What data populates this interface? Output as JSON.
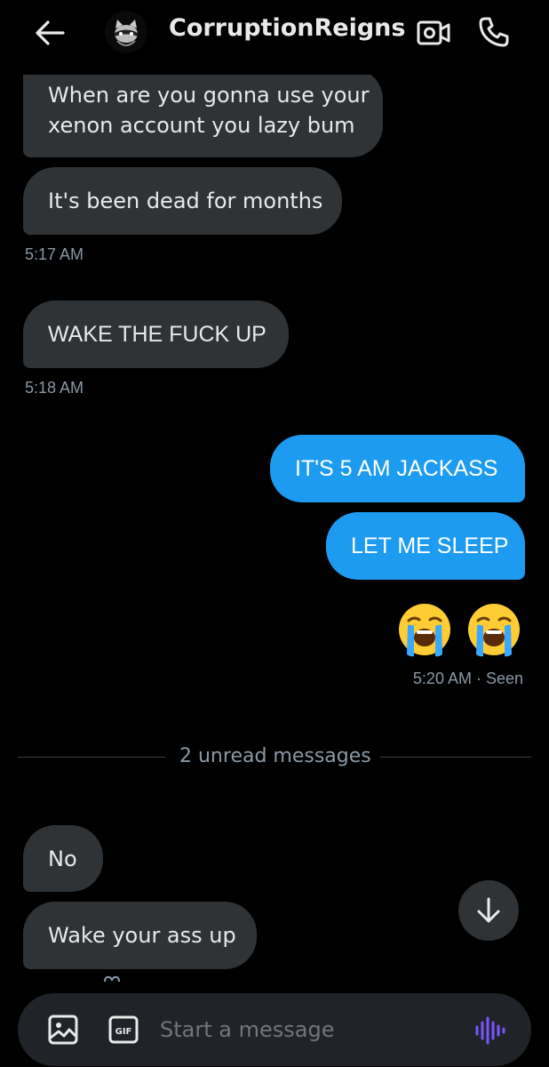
{
  "header": {
    "contact_name": "CorruptionReigns",
    "icons": {
      "back": "arrow-left-icon",
      "video": "video-camera-icon",
      "call": "phone-icon"
    }
  },
  "messages": [
    {
      "text_line1": "When are you gonna use your",
      "text_line2": "xenon account you lazy bum",
      "direction": "incoming"
    },
    {
      "text": "It's been dead for months",
      "direction": "incoming"
    },
    {
      "text": "WAKE THE FUCK UP",
      "direction": "incoming"
    },
    {
      "text": "IT'S 5 AM JACKASS",
      "direction": "outgoing"
    },
    {
      "text": "LET ME SLEEP",
      "direction": "outgoing"
    },
    {
      "emoji": "loudly-crying-face x2",
      "direction": "outgoing"
    },
    {
      "text": "No",
      "direction": "incoming"
    },
    {
      "text": "Wake your ass up",
      "direction": "incoming"
    }
  ],
  "timestamps": {
    "t1": "5:17 AM",
    "t2": "5:18 AM",
    "t3": "5:20 AM · Seen"
  },
  "unread_divider": "2 unread messages",
  "composer": {
    "placeholder": "Start a message",
    "gif_label": "GIF",
    "icons": {
      "image": "image-icon",
      "gif": "gif-icon",
      "voice": "voice-message-icon"
    }
  },
  "colors": {
    "background": "#000000",
    "incoming_bubble": "#2f3336",
    "outgoing_bubble": "#1d9bf0",
    "timestamp": "#8b98a5",
    "composer": "#202327",
    "voice_accent": "#7856ff"
  }
}
